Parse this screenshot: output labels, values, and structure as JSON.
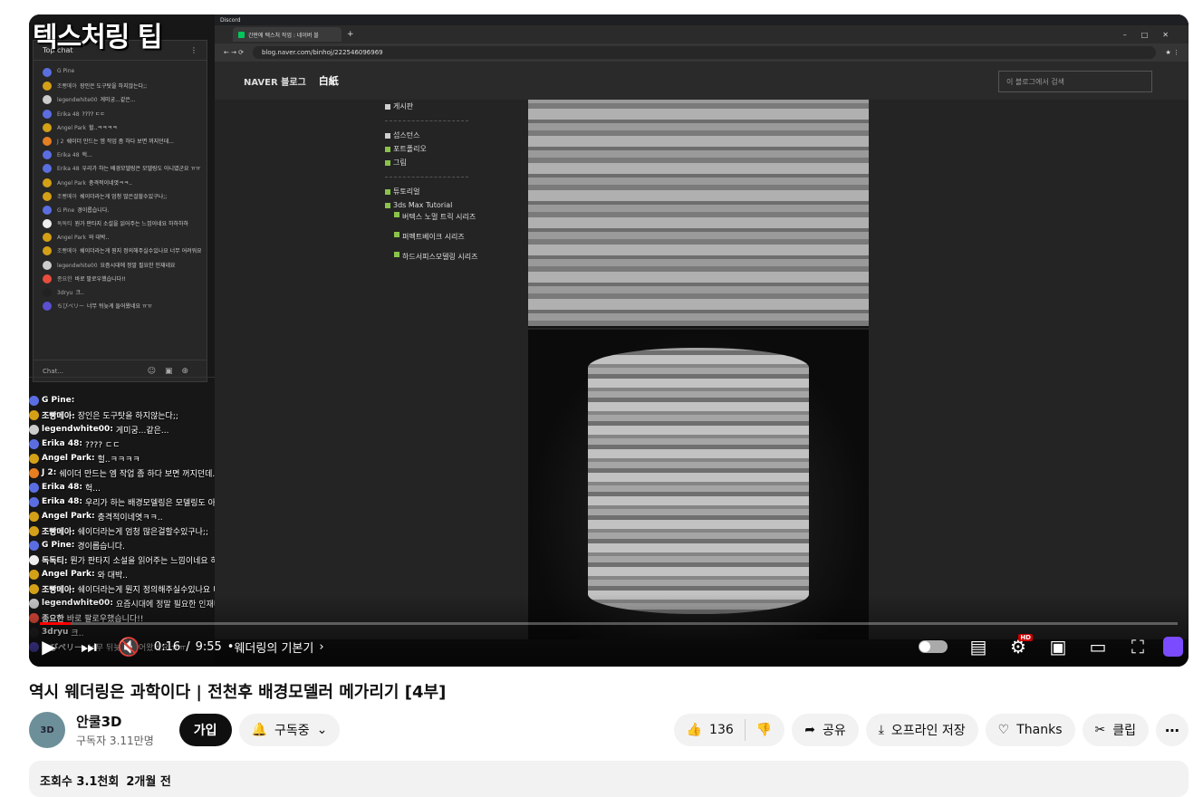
{
  "video": {
    "overlay_title": "텍스처링 팁",
    "time_current": "0:16",
    "time_sep": "/",
    "time_total": "9:55",
    "chapter": "웨더링의 기본기",
    "progress_fraction": 0.027
  },
  "embedded": {
    "discord_label": "Discord",
    "tab_title": "간판에 텍스처 작업 : 네이버 블",
    "url": "blog.naver.com/binhoj/222546096969",
    "naver_logo": "NAVER 블로그",
    "blog_name": "白紙",
    "search_placeholder": "이 블로그에서 검색",
    "nav": [
      {
        "label": "게시판",
        "color": "#cfcfcf"
      },
      {
        "label": "섭스턴스",
        "color": "#cfcfcf"
      },
      {
        "label": "포트폴리오",
        "color": "#8bc34a"
      },
      {
        "label": "그림",
        "color": "#8bc34a"
      },
      {
        "label": "튜토리얼",
        "color": "#8bc34a"
      },
      {
        "label": "3ds Max Tutorial",
        "color": "#8bc34a"
      }
    ],
    "subnav": [
      "버텍스 노멀 트릭 시리즈",
      "퍼펙트베이크 시리즈",
      "하드서피스모델링 시리즈"
    ]
  },
  "small_chat": {
    "header": "Top chat",
    "input_placeholder": "Chat...",
    "rows": [
      {
        "name": "G Pine",
        "text": "",
        "color": "#5b6ee1"
      },
      {
        "name": "조빵메아",
        "text": "장인은 도구탓을 하지않는다;;",
        "color": "#d4a017"
      },
      {
        "name": "legendwhite00",
        "text": "게미궁...같은...",
        "color": "#cccccc"
      },
      {
        "name": "Erika 48",
        "text": "???? ㄷㄷ",
        "color": "#5b6ee1"
      },
      {
        "name": "Angel Park",
        "text": "헐..ㅋㅋㅋㅋ",
        "color": "#d4a017"
      },
      {
        "name": "J 2",
        "text": "쉐이더 만드는 엠 작업 좀 하다 보면 꺼지던데...",
        "color": "#e67e22"
      },
      {
        "name": "Erika 48",
        "text": "헉...",
        "color": "#5b6ee1"
      },
      {
        "name": "Erika 48",
        "text": "우리가 하는 배경모델링은 모델링도 아니였군요 ㅠㅠ",
        "color": "#5b6ee1"
      },
      {
        "name": "Angel Park",
        "text": "충격적이네엿ㅋㅋ..",
        "color": "#d4a017"
      },
      {
        "name": "조빵메아",
        "text": "쉐이더라는게 엄청 많은걸할수있구나;;",
        "color": "#d4a017"
      },
      {
        "name": "G Pine",
        "text": "경이롭습니다.",
        "color": "#5b6ee1"
      },
      {
        "name": "독독티",
        "text": "뭔가 판타지 소설을 읽어주는 느낌이네요 하하하하",
        "color": "#eeeeee"
      },
      {
        "name": "Angel Park",
        "text": "와 대박..",
        "color": "#d4a017"
      },
      {
        "name": "조빵메아",
        "text": "쉐이더라는게 뭔지 정의해주실수있나요 너무 어려워요 ..",
        "color": "#d4a017"
      },
      {
        "name": "legendwhite00",
        "text": "요즘시대에 정말 필요한 인재네요",
        "color": "#cccccc"
      },
      {
        "name": "종요한",
        "text": "바로 팔로우했습니다!!",
        "color": "#e74c3c"
      },
      {
        "name": "3dryu",
        "text": "크..",
        "color": "#222222"
      },
      {
        "name": "ちびペリー",
        "text": "너무 뒤늦게 들어왔네요 ㅠㅠ",
        "color": "#5b4fd1"
      }
    ]
  },
  "big_chat": [
    {
      "name": "G Pine:",
      "text": "",
      "color": "#5b6ee1"
    },
    {
      "name": "조빵메아:",
      "text": "장인은 도구탓을 하지않는다;;",
      "color": "#d4a017"
    },
    {
      "name": "legendwhite00:",
      "text": "게미궁...같은...",
      "color": "#cccccc"
    },
    {
      "name": "Erika 48:",
      "text": "???? ㄷㄷ",
      "color": "#5b6ee1"
    },
    {
      "name": "Angel Park:",
      "text": "헐..ㅋㅋㅋㅋ",
      "color": "#d4a017"
    },
    {
      "name": "J 2:",
      "text": "쉐이더 만드는 엠 작업 좀 하다 보면 꺼지던데...",
      "color": "#e67e22"
    },
    {
      "name": "Erika 48:",
      "text": "헉...",
      "color": "#5b6ee1"
    },
    {
      "name": "Erika 48:",
      "text": "우리가 하는 배경모델링은 모델링도 아니였군요 ㅠㅠ",
      "color": "#5b6ee1"
    },
    {
      "name": "Angel Park:",
      "text": "충격적이네엿ㅋㅋ..",
      "color": "#d4a017"
    },
    {
      "name": "조빵메아:",
      "text": "쉐이더라는게 엄청 많은걸할수있구나;;",
      "color": "#d4a017"
    },
    {
      "name": "G Pine:",
      "text": "경이롭습니다.",
      "color": "#5b6ee1"
    },
    {
      "name": "독독티:",
      "text": "뭔가 판타지 소설을 읽어주는 느낌이네요 하하하하",
      "color": "#eeeeee"
    },
    {
      "name": "Angel Park:",
      "text": "와 대박..",
      "color": "#d4a017"
    },
    {
      "name": "조빵메아:",
      "text": "쉐이더라는게 뭔지 정의해주실수있나요 너무 어려워요 ..",
      "color": "#d4a017"
    },
    {
      "name": "legendwhite00:",
      "text": "요즘시대에 정말 필요한 인재네요",
      "color": "#cccccc"
    },
    {
      "name": "종요한",
      "text": "바로 팔로우했습니다!!",
      "color": "#e74c3c"
    },
    {
      "name": "3dryu",
      "text": "크..",
      "color": "#222222"
    },
    {
      "name": "ちびペリー:",
      "text": "너무 뒤늦게 들어왔네요 ㅠㅠ",
      "color": "#5b4fd1"
    }
  ],
  "meta": {
    "title": "역시 웨더링은 과학이다 | 전천후 배경모델러 메가리기 [4부]",
    "channel": "안쿨3D",
    "channel_avatar_text": "3D",
    "subscribers": "구독자 3.11만명",
    "join": "가입",
    "subscribed": "구독중",
    "likes": "136",
    "share": "공유",
    "offline": "오프라인 저장",
    "thanks": "Thanks",
    "clip": "클립",
    "views": "조회수 3.1천회",
    "age": "2개월 전"
  },
  "colors": {
    "progress": "#ff0000",
    "purple": "#7b4bff",
    "naver_green": "#03c75a"
  }
}
